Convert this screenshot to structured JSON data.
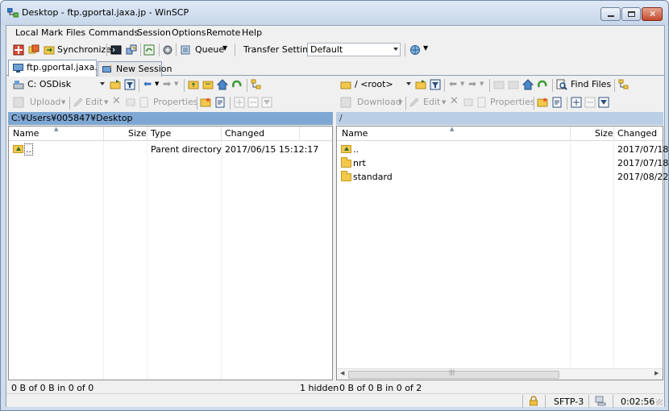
{
  "window": {
    "title": "Desktop - ftp.gportal.jaxa.jp - WinSCP"
  },
  "menu": [
    "Local",
    "Mark",
    "Files",
    "Commands",
    "Session",
    "Options",
    "Remote",
    "Help"
  ],
  "toolbar": {
    "synchronize_label": "Synchronize",
    "queue_label": "Queue",
    "transfer_settings_label": "Transfer Settings",
    "transfer_settings_value": "Default"
  },
  "tabs": {
    "active_session": "ftp.gportal.jaxa.jp",
    "new_session": "New Session"
  },
  "left": {
    "drive": "C: OSDisk",
    "actions": {
      "upload": "Upload",
      "edit": "Edit",
      "properties": "Properties"
    },
    "path": "C:¥Users¥005847¥Desktop",
    "columns": [
      "Name",
      "Size",
      "Type",
      "Changed"
    ],
    "rows": [
      {
        "name": "..",
        "size": "",
        "type": "Parent directory",
        "changed": "2017/06/15  15:12:17"
      }
    ],
    "status": "0 B of 0 B in 0 of 0",
    "hidden": "1 hidden"
  },
  "right": {
    "path_combo": "/ <root>",
    "find_files": "Find Files",
    "actions": {
      "download": "Download",
      "edit": "Edit",
      "properties": "Properties"
    },
    "path": "/",
    "columns": [
      "Name",
      "Size",
      "Changed"
    ],
    "rows": [
      {
        "name": "..",
        "size": "",
        "changed": "2017/07/18"
      },
      {
        "name": "nrt",
        "size": "",
        "changed": "2017/07/18"
      },
      {
        "name": "standard",
        "size": "",
        "changed": "2017/08/22"
      }
    ],
    "status": "0 B of 0 B in 0 of 2"
  },
  "statusbar": {
    "protocol": "SFTP-3",
    "time": "0:02:56"
  },
  "colors": {
    "active_path": "#7fa7d3",
    "inactive_path": "#b9cfe6",
    "title_bar": "#c6d6ea"
  }
}
